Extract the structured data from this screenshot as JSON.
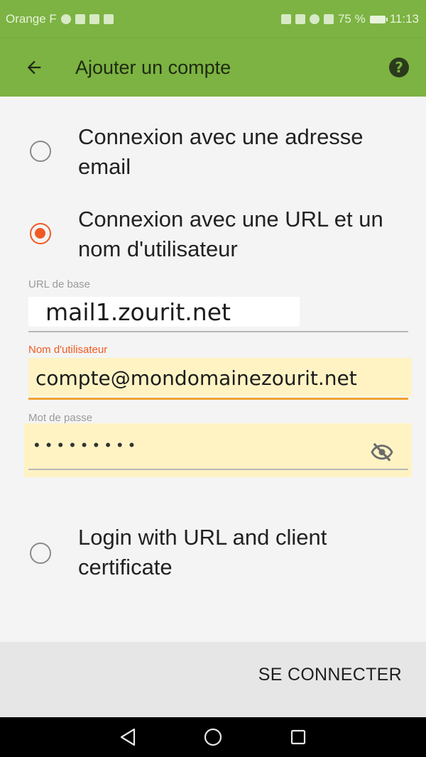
{
  "status_bar": {
    "carrier": "Orange F",
    "battery_percent": "75 %",
    "time": "11:13"
  },
  "app_bar": {
    "title": "Ajouter un compte",
    "back_icon": "arrow-back-icon",
    "help_icon": "help-icon"
  },
  "options": [
    {
      "label": "Connexion avec une adresse email",
      "checked": false
    },
    {
      "label": "Connexion avec une URL et un nom d'utilisateur",
      "checked": true
    },
    {
      "label": "Login with URL and client certificate",
      "checked": false
    }
  ],
  "form": {
    "base_url": {
      "label": "URL de base",
      "value": "mail1.zourit.net"
    },
    "username": {
      "label": "Nom d'utilisateur",
      "value": "compte@mondomainezourit.net"
    },
    "password": {
      "label": "Mot de passe",
      "value": "•••••••••",
      "toggle_icon": "eye-off-icon"
    }
  },
  "actions": {
    "connect_label": "SE CONNECTER"
  },
  "nav": {
    "back_icon": "nav-back-icon",
    "home_icon": "nav-home-icon",
    "recents_icon": "nav-recents-icon"
  },
  "colors": {
    "primary": "#7cb342",
    "accent": "#f15a22",
    "field_highlight": "#fff3c4"
  }
}
